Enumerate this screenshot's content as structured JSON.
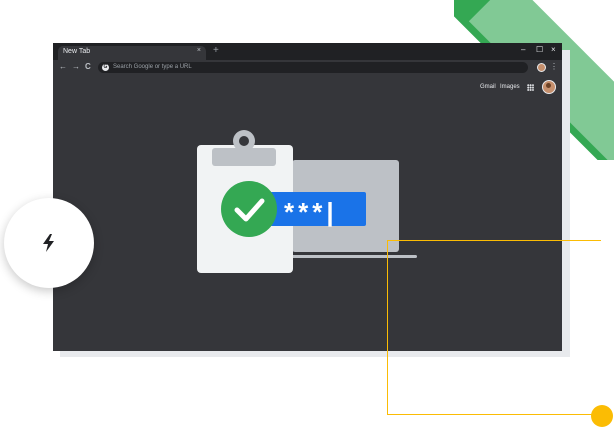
{
  "window": {
    "tab_title": "New Tab",
    "tab_close": "×",
    "new_tab": "+",
    "minimize": "–",
    "maximize": "☐",
    "close": "×"
  },
  "toolbar": {
    "back": "←",
    "forward": "→",
    "reload": "C",
    "omnibox_icon": "G",
    "omnibox_placeholder": "Search Google or type a URL",
    "menu": "⋮"
  },
  "page": {
    "gmail_link": "Gmail",
    "images_link": "Images"
  },
  "illustration": {
    "password_mask": "***|"
  },
  "icons": {
    "badge": "bolt-icon",
    "check": "checkmark-icon",
    "apps": "apps-grid-icon"
  },
  "colors": {
    "accent_green": "#34a853",
    "accent_blue": "#1a73e8",
    "accent_yellow": "#fbbc04",
    "window_dark": "#35363a"
  }
}
